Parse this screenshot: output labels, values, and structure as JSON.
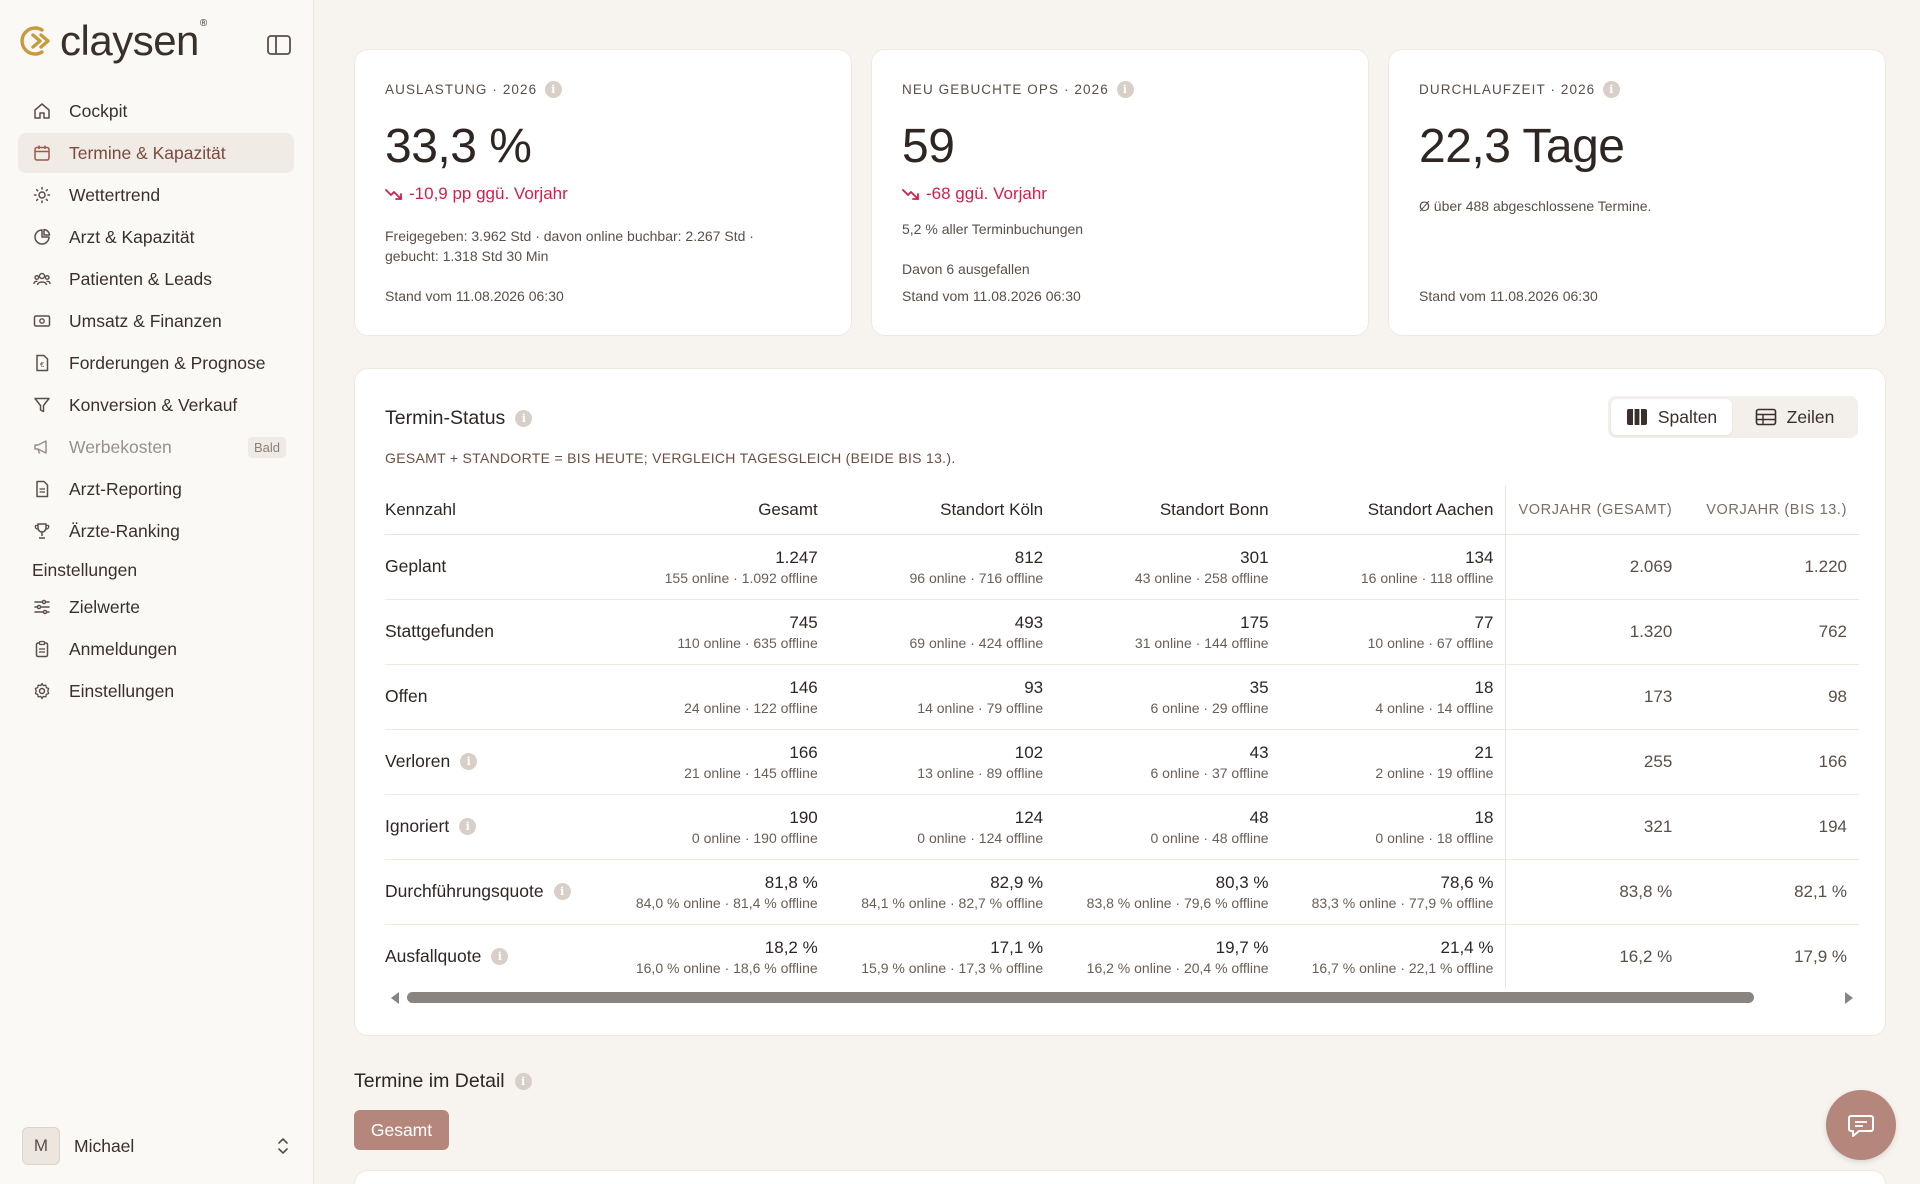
{
  "brand": {
    "name": "claysen",
    "reg": "®"
  },
  "nav": {
    "items": [
      {
        "label": "Cockpit"
      },
      {
        "label": "Termine & Kapazität"
      },
      {
        "label": "Wettertrend"
      },
      {
        "label": "Arzt & Kapazität"
      },
      {
        "label": "Patienten & Leads"
      },
      {
        "label": "Umsatz & Finanzen"
      },
      {
        "label": "Forderungen & Prognose"
      },
      {
        "label": "Konversion & Verkauf"
      },
      {
        "label": "Werbekosten",
        "badge": "Bald"
      },
      {
        "label": "Arzt-Reporting"
      },
      {
        "label": "Ärzte-Ranking"
      }
    ],
    "settings_section": "Einstellungen",
    "settings_items": [
      {
        "label": "Zielwerte"
      },
      {
        "label": "Anmeldungen"
      },
      {
        "label": "Einstellungen"
      }
    ]
  },
  "user": {
    "initial": "M",
    "name": "Michael"
  },
  "kpis": [
    {
      "label": "AUSLASTUNG · 2026",
      "value": "33,3 %",
      "delta": "-10,9 pp ggü. Vorjahr",
      "sub1": "Freigegeben: 3.962 Std · davon online buchbar: 2.267 Std · gebucht: 1.318 Std 30 Min",
      "footer": "Stand vom 11.08.2026 06:30"
    },
    {
      "label": "NEU GEBUCHTE OPS · 2026",
      "value": "59",
      "delta": "-68 ggü. Vorjahr",
      "sub1": "5,2 % aller Terminbuchungen",
      "sub2": "Davon 6 ausgefallen",
      "footer": "Stand vom 11.08.2026 06:30"
    },
    {
      "label": "DURCHLAUFZEIT · 2026",
      "value": "22,3 Tage",
      "sub1": "Ø über 488 abgeschlossene Termine.",
      "footer": "Stand vom 11.08.2026 06:30"
    }
  ],
  "status": {
    "title": "Termin-Status",
    "note": "GESAMT + STANDORTE = BIS HEUTE; VERGLEICH TAGESGLEICH (BEIDE BIS 13.).",
    "toggle": {
      "columns": "Spalten",
      "rows": "Zeilen"
    },
    "headers": [
      "Kennzahl",
      "Gesamt",
      "Standort Köln",
      "Standort Bonn",
      "Standort Aachen",
      "VORJAHR (GESAMT)",
      "VORJAHR (BIS 13.)"
    ],
    "rows": [
      {
        "label": "Geplant",
        "info": false,
        "cells": [
          {
            "main": "1.247",
            "sub": "155 online · 1.092 offline"
          },
          {
            "main": "812",
            "sub": "96 online · 716 offline"
          },
          {
            "main": "301",
            "sub": "43 online · 258 offline"
          },
          {
            "main": "134",
            "sub": "16 online · 118 offline"
          }
        ],
        "prev": [
          "2.069",
          "1.220"
        ]
      },
      {
        "label": "Stattgefunden",
        "info": false,
        "cells": [
          {
            "main": "745",
            "sub": "110 online · 635 offline"
          },
          {
            "main": "493",
            "sub": "69 online · 424 offline"
          },
          {
            "main": "175",
            "sub": "31 online · 144 offline"
          },
          {
            "main": "77",
            "sub": "10 online · 67 offline"
          }
        ],
        "prev": [
          "1.320",
          "762"
        ]
      },
      {
        "label": "Offen",
        "info": false,
        "cells": [
          {
            "main": "146",
            "sub": "24 online · 122 offline"
          },
          {
            "main": "93",
            "sub": "14 online · 79 offline"
          },
          {
            "main": "35",
            "sub": "6 online · 29 offline"
          },
          {
            "main": "18",
            "sub": "4 online · 14 offline"
          }
        ],
        "prev": [
          "173",
          "98"
        ]
      },
      {
        "label": "Verloren",
        "info": true,
        "cells": [
          {
            "main": "166",
            "sub": "21 online · 145 offline"
          },
          {
            "main": "102",
            "sub": "13 online · 89 offline"
          },
          {
            "main": "43",
            "sub": "6 online · 37 offline"
          },
          {
            "main": "21",
            "sub": "2 online · 19 offline"
          }
        ],
        "prev": [
          "255",
          "166"
        ]
      },
      {
        "label": "Ignoriert",
        "info": true,
        "cells": [
          {
            "main": "190",
            "sub": "0 online · 190 offline"
          },
          {
            "main": "124",
            "sub": "0 online · 124 offline"
          },
          {
            "main": "48",
            "sub": "0 online · 48 offline"
          },
          {
            "main": "18",
            "sub": "0 online · 18 offline"
          }
        ],
        "prev": [
          "321",
          "194"
        ]
      },
      {
        "label": "Durchführungsquote",
        "info": true,
        "cells": [
          {
            "main": "81,8 %",
            "sub": "84,0 % online · 81,4 % offline"
          },
          {
            "main": "82,9 %",
            "sub": "84,1 % online · 82,7 % offline"
          },
          {
            "main": "80,3 %",
            "sub": "83,8 % online · 79,6 % offline"
          },
          {
            "main": "78,6 %",
            "sub": "83,3 % online · 77,9 % offline"
          }
        ],
        "prev": [
          "83,8 %",
          "82,1 %"
        ]
      },
      {
        "label": "Ausfallquote",
        "info": true,
        "cells": [
          {
            "main": "18,2 %",
            "sub": "16,0 % online · 18,6 % offline"
          },
          {
            "main": "17,1 %",
            "sub": "15,9 % online · 17,3 % offline"
          },
          {
            "main": "19,7 %",
            "sub": "16,2 % online · 20,4 % offline"
          },
          {
            "main": "21,4 %",
            "sub": "16,7 % online · 22,1 % offline"
          }
        ],
        "prev": [
          "16,2 %",
          "17,9 %"
        ]
      }
    ]
  },
  "detail": {
    "title": "Termine im Detail",
    "button": "Gesamt"
  },
  "colors": {
    "accent": "#b5877c",
    "negative": "#d21f4a",
    "active_nav_bg": "#f1ebe5"
  },
  "icons": {
    "info": "info-icon",
    "chat": "chat-icon"
  }
}
